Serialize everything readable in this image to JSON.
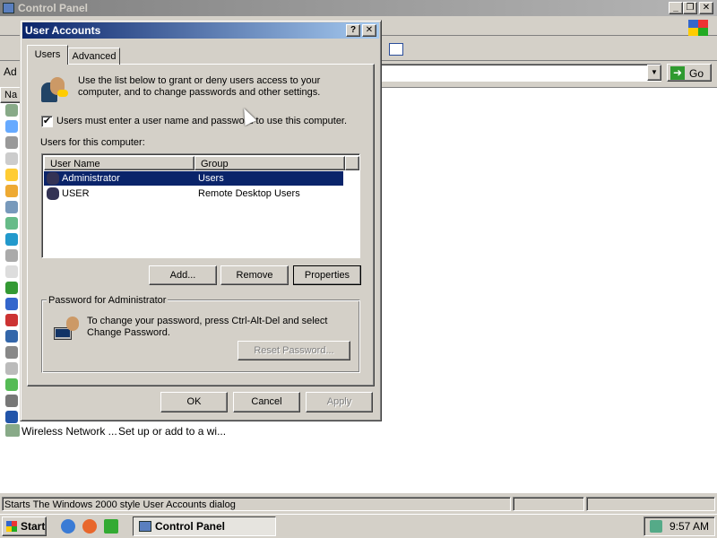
{
  "control_panel": {
    "title": "Control Panel",
    "address_prefix": "Ad",
    "go_label": "Go",
    "list_header_name": "Na",
    "wireless": {
      "name": "Wireless Network ...",
      "desc": "Set up or add to a wi..."
    },
    "status_text": "Starts The Windows 2000 style User Accounts dialog"
  },
  "dialog": {
    "title": "User Accounts",
    "help_label": "?",
    "close_label": "✕",
    "tabs": [
      {
        "label": "Users"
      },
      {
        "label": "Advanced"
      }
    ],
    "intro_text": "Use the list below to grant or deny users access to your computer, and to change passwords and other settings.",
    "must_login_label": "Users must enter a user name and password to use this computer.",
    "must_login_checked": "✔",
    "users_label": "Users for this computer:",
    "columns": [
      "User Name",
      "Group"
    ],
    "users": [
      {
        "name": "Administrator",
        "group": "Users"
      },
      {
        "name": "USER",
        "group": "Remote Desktop Users"
      }
    ],
    "add_label": "Add...",
    "remove_label": "Remove",
    "properties_label": "Properties",
    "password_group_label": "Password for Administrator",
    "password_text": "To change your password, press Ctrl-Alt-Del and select Change Password.",
    "reset_label": "Reset Password...",
    "ok_label": "OK",
    "cancel_label": "Cancel",
    "apply_label": "Apply"
  },
  "taskbar": {
    "start_label": "Start",
    "task_label": "Control Panel",
    "clock": "9:57 AM"
  },
  "colors": {
    "selection": "#0a246a",
    "dialog_title_start": "#0a246a",
    "dialog_title_end": "#a6caf0",
    "face": "#d4d0c8"
  }
}
